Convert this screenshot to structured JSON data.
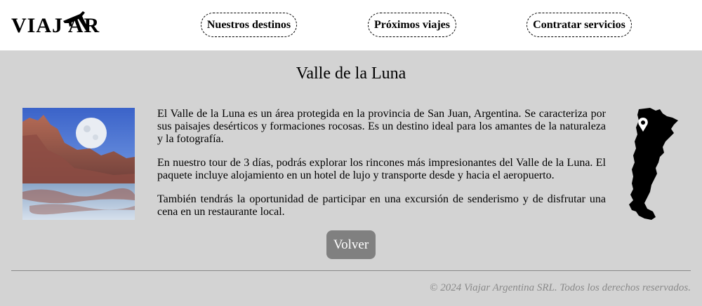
{
  "header": {
    "logo_text": "VIAJ  AR",
    "nav": [
      {
        "label": "Nuestros destinos"
      },
      {
        "label": "Próximos viajes"
      },
      {
        "label": "Contratar servicios"
      }
    ]
  },
  "main": {
    "title": "Valle de la Luna",
    "paragraphs": [
      "El Valle de la Luna es un área protegida en la provincia de San Juan, Argentina. Se caracteriza por sus paisajes desérticos y formaciones rocosas. Es un destino ideal para los amantes de la naturaleza y la fotografía.",
      "En nuestro tour de 3 días, podrás explorar los rincones más impresionantes del Valle de la Luna. El paquete incluye alojamiento en un hotel de lujo y transporte desde y hacia el aeropuerto.",
      "También tendrás la oportunidad de participar en una excursión de senderismo y de disfrutar una cena en un restaurante local."
    ],
    "back_label": "Volver"
  },
  "footer": {
    "copyright": "© 2024 Viajar Argentina SRL. Todos los derechos reservados."
  },
  "colors": {
    "page_bg": "#d3d3d3",
    "header_bg": "#ffffff",
    "button_bg": "#808080",
    "footer_text": "#8a8a8a"
  },
  "icons": {
    "logo_plane": "airplane-icon",
    "map": "argentina-map-icon",
    "map_pin": "location-pin-icon"
  }
}
